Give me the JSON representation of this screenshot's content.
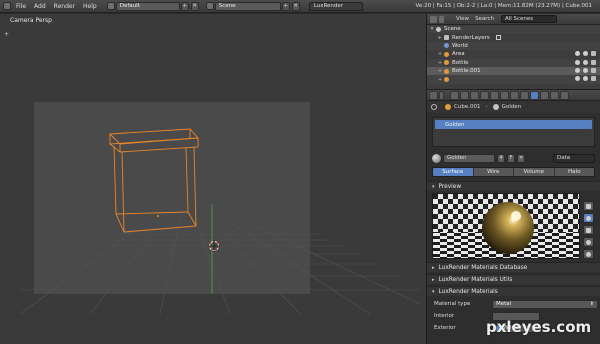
{
  "topbar": {
    "menus": [
      "File",
      "Add",
      "Render",
      "Help"
    ],
    "screen_layout": "Default",
    "scene": "Scene",
    "renderer": "LuxRender",
    "stats": "Ve:20 | Fa:15 | Ob:2-2 | La:0 | Mem:11.82M (23.27M) | Cube.001"
  },
  "viewport": {
    "label": "Camera Persp",
    "plus": "+"
  },
  "outliner": {
    "menus": [
      "View",
      "Search"
    ],
    "filter": "All Scenes",
    "items": [
      {
        "label": "Scene",
        "color": "#c8c8c8"
      },
      {
        "label": "RenderLayers",
        "color": "#bbbbbb"
      },
      {
        "label": "World",
        "color": "#6f9ad6"
      },
      {
        "label": "Area",
        "color": "#e39a3b"
      },
      {
        "label": "Bottle",
        "color": "#e39a3b"
      },
      {
        "label": "Bottle.001",
        "color": "#e39a3b"
      },
      {
        "label": "",
        "color": "#e39a3b"
      }
    ]
  },
  "properties": {
    "crumb_object": "Cube.001",
    "crumb_material": "Golden",
    "slot_name": "Golden",
    "material_name": "Golden",
    "users": "4",
    "fake_user": "F",
    "link": "Data",
    "subtabs": [
      "Surface",
      "Wire",
      "Volume",
      "Halo"
    ],
    "active_subtab": "Surface",
    "sections": {
      "preview": "Preview",
      "database": "LuxRender Materials Database",
      "utils": "LuxRender Materials Utils",
      "materials": "LuxRender Materials"
    },
    "material_type_label": "Material type",
    "material_type_value": "Metal",
    "interior_label": "Interior",
    "interior_value": "",
    "exterior_label": "Exterior",
    "exterior_value": "World"
  },
  "watermark": "pxleyes.com",
  "colors": {
    "accent": "#5680c2",
    "object_outline": "#e8862a",
    "y_axis": "#4ca64c"
  }
}
